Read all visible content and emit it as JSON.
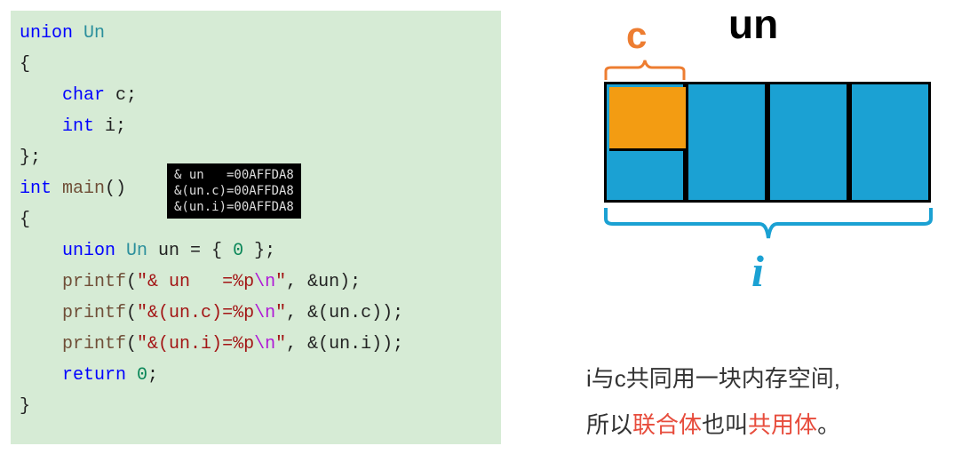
{
  "code": {
    "l1_union": "union",
    "l1_Un": " Un",
    "l2": "{",
    "l3_char": "    char",
    "l3_c": " c;",
    "l4_int": "    int",
    "l4_i": " i;",
    "l5": "};",
    "l6_int": "int",
    "l6_main": " main",
    "l6_paren": "()",
    "l7": "{",
    "l8_union": "    union",
    "l8_Un": " Un",
    "l8_un": " un = { ",
    "l8_zero": "0",
    "l8_end": " };",
    "l9_pre": "    ",
    "l9_printf": "printf",
    "l9_open": "(",
    "l9_str1": "\"& un   =%p",
    "l9_esc": "\\n",
    "l9_str2": "\"",
    "l9_rest": ", &un);",
    "l10_pre": "    ",
    "l10_printf": "printf",
    "l10_open": "(",
    "l10_str1": "\"&(un.c)=%p",
    "l10_esc": "\\n",
    "l10_str2": "\"",
    "l10_rest": ", &(un.c));",
    "l11_pre": "    ",
    "l11_printf": "printf",
    "l11_open": "(",
    "l11_str1": "\"&(un.i)=%p",
    "l11_esc": "\\n",
    "l11_str2": "\"",
    "l11_rest": ", &(un.i));",
    "l12_return": "    return",
    "l12_zero": " 0",
    "l12_semi": ";",
    "l13": "}"
  },
  "output": {
    "line1": "& un   =00AFFDA8",
    "line2": "&(un.c)=00AFFDA8",
    "line3": "&(un.i)=00AFFDA8"
  },
  "labels": {
    "un": "un",
    "c": "c",
    "i": "i"
  },
  "caption": {
    "p1a": "i与c共同用一块内存空间,",
    "p2a": "所以",
    "p2b": "联合体",
    "p2c": "也叫",
    "p2d": "共用体",
    "p2e": "。"
  }
}
